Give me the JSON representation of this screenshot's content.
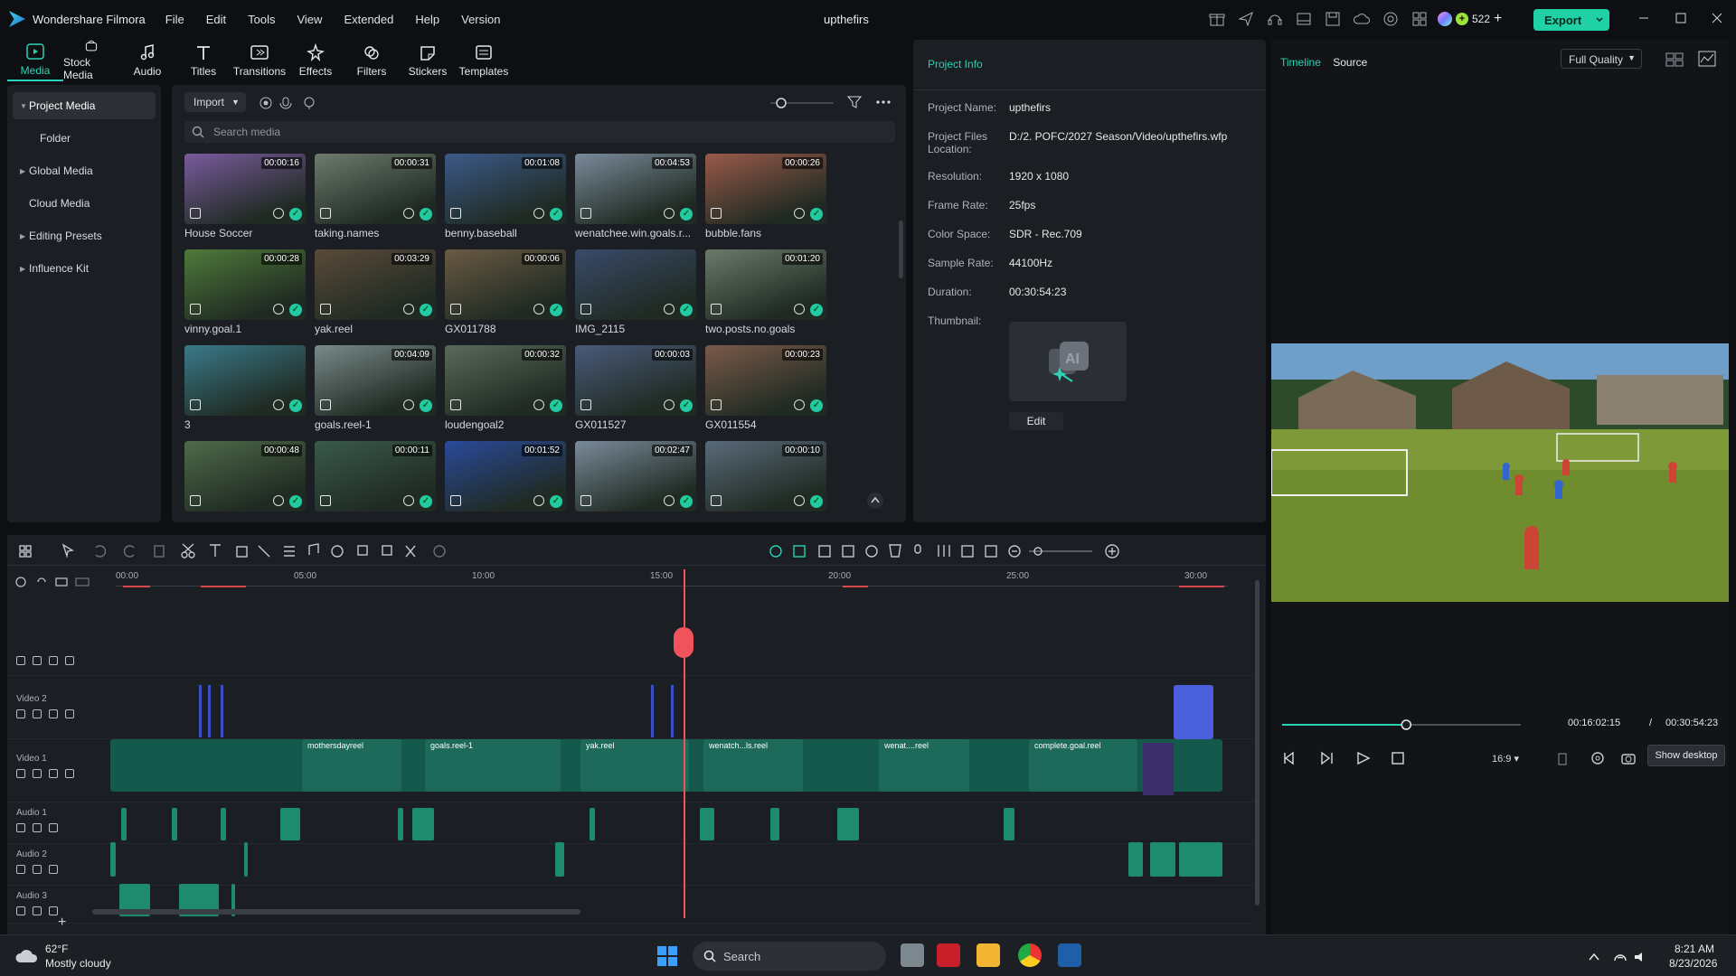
{
  "app": {
    "name": "Wondershare Filmora",
    "project_title": "upthefirs",
    "credits": "522",
    "export_label": "Export"
  },
  "menu": [
    "File",
    "Edit",
    "Tools",
    "View",
    "Extended",
    "Help",
    "Version"
  ],
  "tools": [
    {
      "label": "Media",
      "icon": "media-icon",
      "active": true
    },
    {
      "label": "Stock Media",
      "icon": "stock-media-icon"
    },
    {
      "label": "Audio",
      "icon": "music-note-icon"
    },
    {
      "label": "Titles",
      "icon": "text-t-icon"
    },
    {
      "label": "Transitions",
      "icon": "transitions-icon"
    },
    {
      "label": "Effects",
      "icon": "effects-icon"
    },
    {
      "label": "Filters",
      "icon": "filters-icon"
    },
    {
      "label": "Stickers",
      "icon": "stickers-icon"
    },
    {
      "label": "Templates",
      "icon": "templates-icon"
    }
  ],
  "sidebar": [
    {
      "label": "Project Media",
      "expand": true,
      "active": true
    },
    {
      "label": "Folder",
      "expand": false
    },
    {
      "label": "Global Media",
      "expand": true
    },
    {
      "label": "Cloud Media",
      "expand": false
    },
    {
      "label": "Editing Presets",
      "expand": true
    },
    {
      "label": "Influence Kit",
      "expand": true
    }
  ],
  "media": {
    "import_label": "Import",
    "search_placeholder": "Search media",
    "items": [
      {
        "name": "House Soccer",
        "duration": "00:00:16",
        "color": "#7a5b9e"
      },
      {
        "name": "taking.names",
        "duration": "00:00:31",
        "color": "#6d7a6e"
      },
      {
        "name": "benny.baseball",
        "duration": "00:01:08",
        "color": "#3c5a8a"
      },
      {
        "name": "wenatchee.win.goals.r...",
        "duration": "00:04:53",
        "color": "#7a8a9a"
      },
      {
        "name": "bubble.fans",
        "duration": "00:00:26",
        "color": "#9a5a4a"
      },
      {
        "name": "vinny.goal.1",
        "duration": "00:00:28",
        "color": "#4f7a3a"
      },
      {
        "name": "yak.reel",
        "duration": "00:03:29",
        "color": "#5a4a3a"
      },
      {
        "name": "GX011788",
        "duration": "00:00:06",
        "color": "#6a5a44"
      },
      {
        "name": "IMG_2115",
        "duration": "",
        "color": "#3a4a6a"
      },
      {
        "name": "two.posts.no.goals",
        "duration": "00:01:20",
        "color": "#6a7a6a"
      },
      {
        "name": "3",
        "duration": "",
        "color": "#3a7a8a"
      },
      {
        "name": "goals.reel-1",
        "duration": "00:04:09",
        "color": "#7a8a8a"
      },
      {
        "name": "loudengoal2",
        "duration": "00:00:32",
        "color": "#5a6a5a"
      },
      {
        "name": "GX011527",
        "duration": "00:00:03",
        "color": "#4a5a7a"
      },
      {
        "name": "GX011554",
        "duration": "00:00:23",
        "color": "#7a5a4a"
      },
      {
        "name": "",
        "duration": "00:00:48",
        "color": "#4f6a4a"
      },
      {
        "name": "",
        "duration": "00:00:11",
        "color": "#3a5a4a"
      },
      {
        "name": "",
        "duration": "00:01:52",
        "color": "#2a4a9a"
      },
      {
        "name": "",
        "duration": "00:02:47",
        "color": "#7a8a9a"
      },
      {
        "name": "",
        "duration": "00:00:10",
        "color": "#5a6a7a"
      }
    ]
  },
  "project_info": {
    "header": "Project Info",
    "rows": [
      {
        "label": "Project Name:",
        "value": "upthefirs"
      },
      {
        "label": "Project Files Location:",
        "value": "D:/2. POFC/2027 Season/Video/upthefirs.wfp"
      },
      {
        "label": "Resolution:",
        "value": "1920 x 1080"
      },
      {
        "label": "Frame Rate:",
        "value": "25fps"
      },
      {
        "label": "Color Space:",
        "value": "SDR - Rec.709"
      },
      {
        "label": "Sample Rate:",
        "value": "44100Hz"
      },
      {
        "label": "Duration:",
        "value": "00:30:54:23"
      },
      {
        "label": "Thumbnail:",
        "value": ""
      }
    ],
    "edit_label": "Edit"
  },
  "player": {
    "tab_timeline": "Timeline",
    "tab_source": "Source",
    "quality": "Full Quality",
    "current_time": "00:16:02:15",
    "separator": "/",
    "total_time": "00:30:54:23",
    "progress": 0.52,
    "aspect": "16:9",
    "tooltip": "Show desktop"
  },
  "timeline": {
    "ruler": [
      "00:00",
      "05:00",
      "10:00",
      "15:00",
      "20:00",
      "25:00",
      "30:00"
    ],
    "tracks": [
      {
        "label": ""
      },
      {
        "label": "Video 2"
      },
      {
        "label": "Video 1"
      },
      {
        "label": "Audio 1"
      },
      {
        "label": "Audio 2"
      },
      {
        "label": "Audio 3"
      }
    ],
    "clips": [
      "mothersdayreel",
      "goals.reel-1",
      "yak.reel",
      "wenatch...ls.reel",
      "wenat....reel",
      "complete.goal.reel"
    ]
  },
  "taskbar": {
    "weather_temp": "62°F",
    "weather_desc": "Mostly cloudy",
    "search_label": "Search",
    "time": "8:21 AM",
    "date": "8/23/2026"
  }
}
